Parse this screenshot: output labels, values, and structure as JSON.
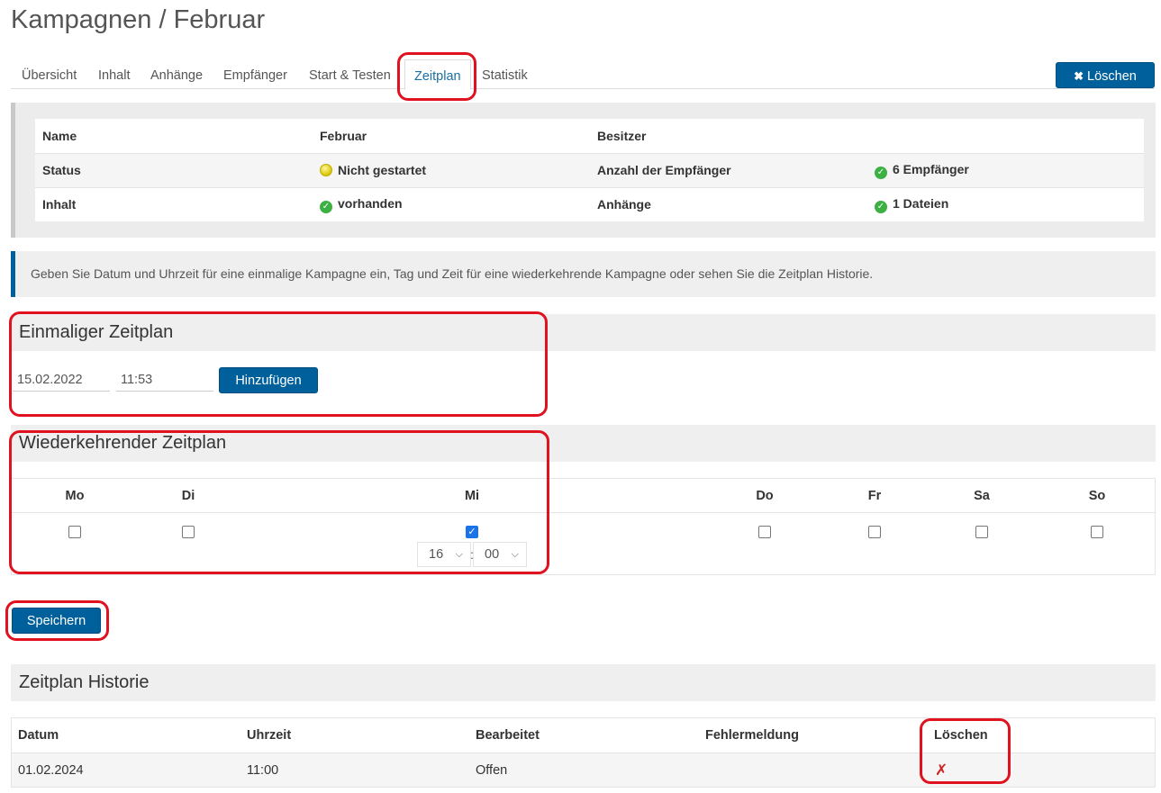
{
  "page": {
    "title": "Kampagnen / Februar"
  },
  "tabs": [
    {
      "label": "Übersicht"
    },
    {
      "label": "Inhalt"
    },
    {
      "label": "Anhänge"
    },
    {
      "label": "Empfänger"
    },
    {
      "label": "Start & Testen"
    },
    {
      "label": "Zeitplan",
      "active": true
    },
    {
      "label": "Statistik"
    }
  ],
  "toolbar": {
    "delete_label": "Löschen"
  },
  "info": {
    "rows": [
      {
        "k1": "Name",
        "v1": "Februar",
        "k2": "Besitzer",
        "v2": ""
      },
      {
        "k1": "Status",
        "v1": "Nicht gestartet",
        "k2": "Anzahl der Empfänger",
        "v2": "6 Empfänger"
      },
      {
        "k1": "Inhalt",
        "v1": "vorhanden",
        "k2": "Anhänge",
        "v2": "1 Dateien"
      }
    ]
  },
  "hint": "Geben Sie Datum und Uhrzeit für eine einmalige Kampagne ein, Tag und Zeit für eine wiederkehrende Kampagne oder sehen Sie die Zeitplan Historie.",
  "once": {
    "title": "Einmaliger Zeitplan",
    "date": "15.02.2022",
    "time": "11:53",
    "add_label": "Hinzufügen"
  },
  "recurring": {
    "title": "Wiederkehrender Zeitplan",
    "days": [
      {
        "label": "Mo",
        "checked": false
      },
      {
        "label": "Di",
        "checked": false
      },
      {
        "label": "Mi",
        "checked": true
      },
      {
        "label": "Do",
        "checked": false
      },
      {
        "label": "Fr",
        "checked": false
      },
      {
        "label": "Sa",
        "checked": false
      },
      {
        "label": "So",
        "checked": false
      }
    ],
    "hour": "16",
    "minute": "00",
    "separator": ":"
  },
  "save_label": "Speichern",
  "history": {
    "title": "Zeitplan Historie",
    "columns": [
      "Datum",
      "Uhrzeit",
      "Bearbeitet",
      "Fehlermeldung",
      "Löschen"
    ],
    "rows": [
      {
        "date": "01.02.2024",
        "time": "11:00",
        "status": "Offen",
        "error": ""
      }
    ]
  },
  "colors": {
    "primary": "#00609b",
    "annotation": "#e0121f",
    "success": "#3cb043"
  },
  "icons": {
    "delete": "close-icon",
    "ok": "check-circle-icon",
    "status": "yellow-dot-icon",
    "row_delete": "red-x-icon"
  }
}
